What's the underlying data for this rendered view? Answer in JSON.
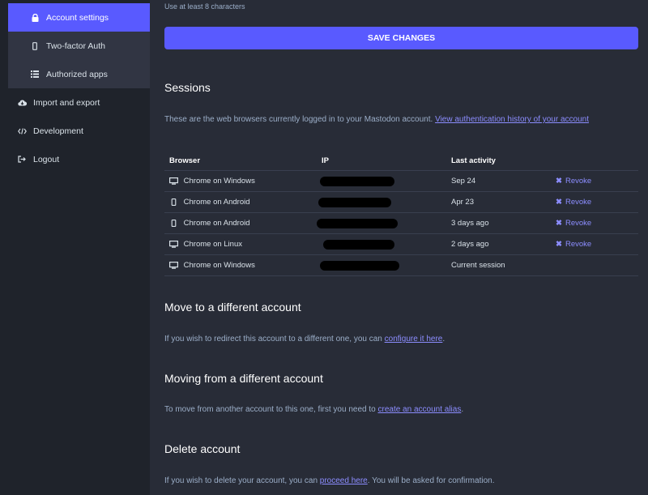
{
  "sidebar": {
    "account_settings": "Account settings",
    "two_factor": "Two-factor Auth",
    "authorized_apps": "Authorized apps",
    "import_export": "Import and export",
    "development": "Development",
    "logout": "Logout"
  },
  "password_hint": "Use at least 8 characters",
  "save_button": "SAVE CHANGES",
  "sessions": {
    "title": "Sessions",
    "description": "These are the web browsers currently logged in to your Mastodon account.",
    "history_link": "View authentication history of your account",
    "columns": {
      "browser": "Browser",
      "ip": "IP",
      "last_activity": "Last activity"
    },
    "rows": [
      {
        "browser": "Chrome on Windows",
        "device": "desktop",
        "last_activity": "Sep 24",
        "action": "Revoke"
      },
      {
        "browser": "Chrome on Android",
        "device": "mobile",
        "last_activity": "Apr 23",
        "action": "Revoke"
      },
      {
        "browser": "Chrome on Android",
        "device": "mobile",
        "last_activity": "3 days ago",
        "action": "Revoke"
      },
      {
        "browser": "Chrome on Linux",
        "device": "desktop",
        "last_activity": "2 days ago",
        "action": "Revoke"
      },
      {
        "browser": "Chrome on Windows",
        "device": "desktop",
        "last_activity": "Current session",
        "action": ""
      }
    ]
  },
  "move_to": {
    "title": "Move to a different account",
    "text": "If you wish to redirect this account to a different one, you can",
    "link": "configure it here",
    "end": "."
  },
  "move_from": {
    "title": "Moving from a different account",
    "text": "To move from another account to this one, first you need to",
    "link": "create an account alias",
    "end": "."
  },
  "delete": {
    "title": "Delete account",
    "text": "If you wish to delete your account, you can",
    "link": "proceed here",
    "end": ". You will be asked for confirmation."
  },
  "colors": {
    "accent": "#595aff",
    "link": "#8c8dff",
    "bg": "#282c37",
    "sidebar": "#1f232b"
  }
}
